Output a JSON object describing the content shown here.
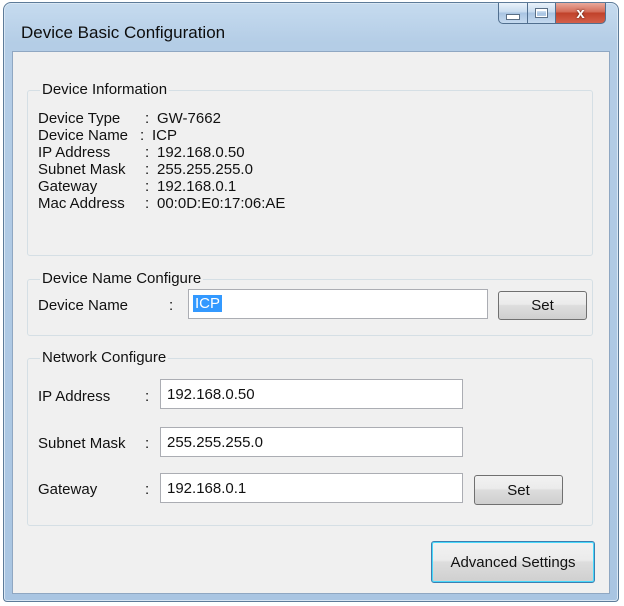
{
  "window": {
    "title": "Device Basic Configuration",
    "min_glyph": "",
    "max_glyph": "",
    "close_glyph": "x"
  },
  "device_info": {
    "legend": "Device Information",
    "rows": [
      {
        "label": "Device Type",
        "sep": ":",
        "value": "GW-7662"
      },
      {
        "label": "Device Name",
        "sep": ":",
        "value": "ICP"
      },
      {
        "label": "IP Address",
        "sep": ":",
        "value": "192.168.0.50"
      },
      {
        "label": "Subnet Mask",
        "sep": ":",
        "value": "255.255.255.0"
      },
      {
        "label": "Gateway",
        "sep": ":",
        "value": "192.168.0.1"
      },
      {
        "label": "Mac Address",
        "sep": ":",
        "value": "00:0D:E0:17:06:AE"
      }
    ]
  },
  "name_config": {
    "legend": "Device Name Configure",
    "label": "Device Name",
    "sep": ":",
    "value": "ICP",
    "set_label": "Set"
  },
  "network_config": {
    "legend": "Network Configure",
    "ip_label": "IP Address",
    "ip_sep": ":",
    "ip_value": "192.168.0.50",
    "mask_label": "Subnet Mask",
    "mask_sep": ":",
    "mask_value": "255.255.255.0",
    "gw_label": "Gateway",
    "gw_sep": ":",
    "gw_value": "192.168.0.1",
    "set_label": "Set"
  },
  "advanced_label": "Advanced Settings"
}
